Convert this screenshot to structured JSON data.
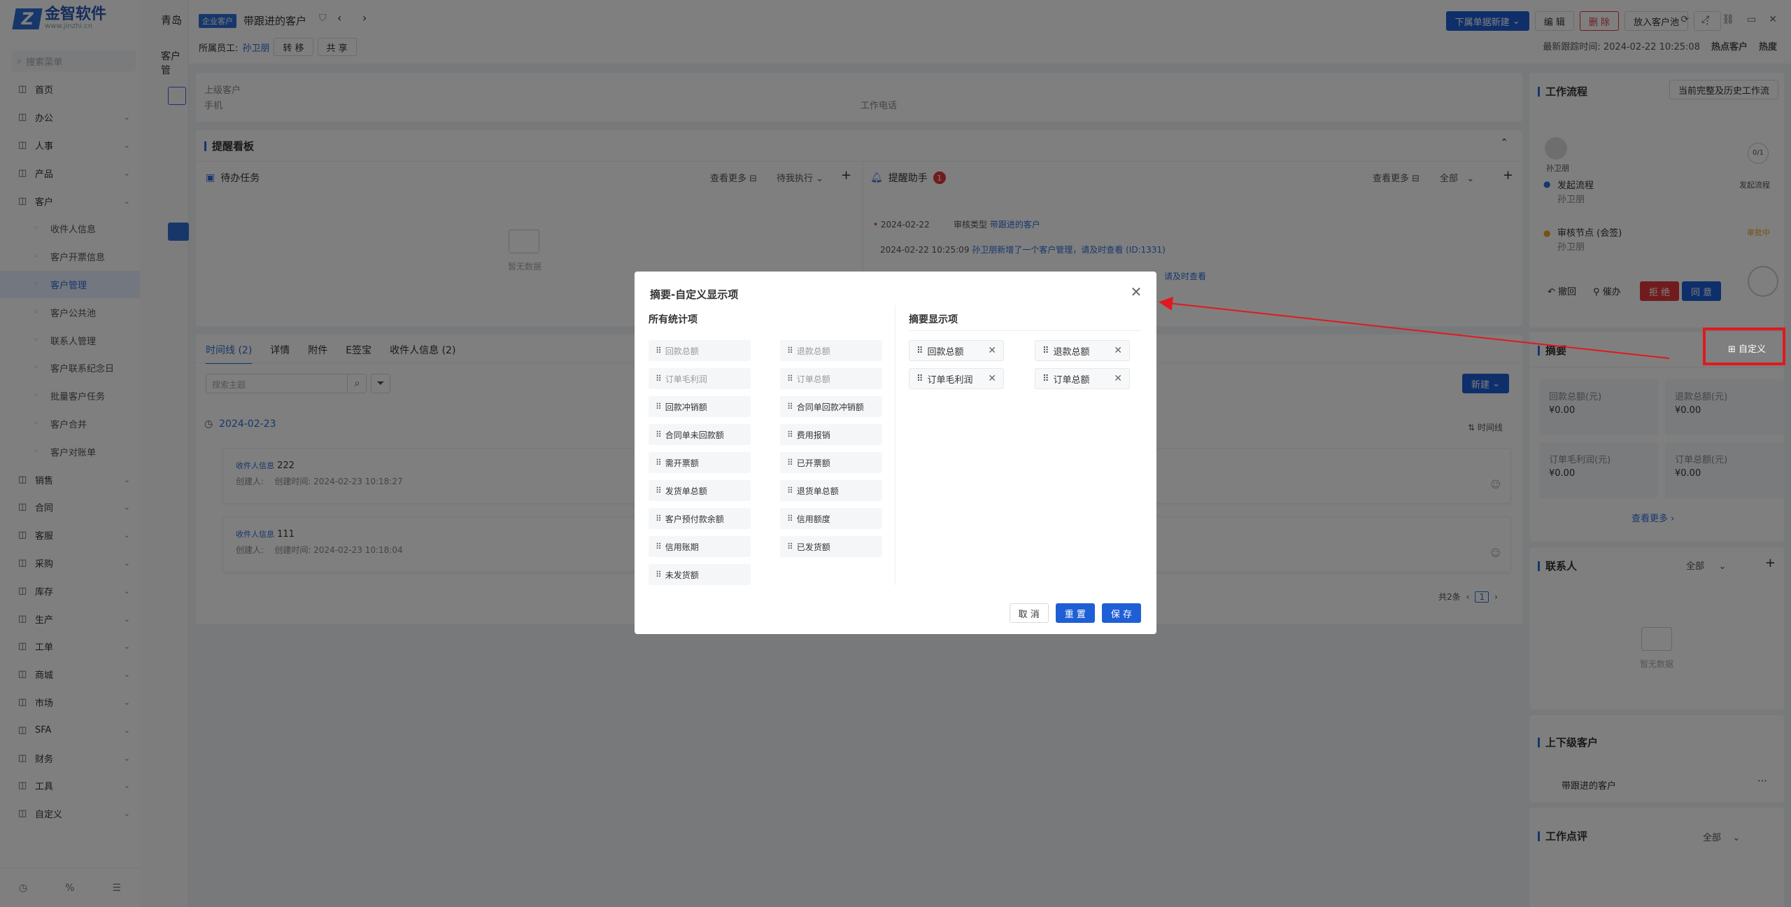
{
  "sidebar": {
    "logo_text": "金智软件",
    "logo_sub": "www.jinzhi.cn",
    "search_placeholder": "搜索菜单",
    "nav": [
      {
        "label": "首页",
        "icon": "home-icon",
        "sub": false,
        "chev": false
      },
      {
        "label": "办公",
        "icon": "office-icon",
        "sub": false,
        "chev": true
      },
      {
        "label": "人事",
        "icon": "user-icon",
        "sub": false,
        "chev": true
      },
      {
        "label": "产品",
        "icon": "product-icon",
        "sub": false,
        "chev": true
      },
      {
        "label": "客户",
        "icon": "customer-icon",
        "sub": false,
        "chev": true
      },
      {
        "label": "收件人信息",
        "sub": true
      },
      {
        "label": "客户开票信息",
        "sub": true
      },
      {
        "label": "客户管理",
        "sub": true,
        "active": true
      },
      {
        "label": "客户公共池",
        "sub": true
      },
      {
        "label": "联系人管理",
        "sub": true
      },
      {
        "label": "客户联系纪念日",
        "sub": true
      },
      {
        "label": "批量客户任务",
        "sub": true
      },
      {
        "label": "客户合并",
        "sub": true
      },
      {
        "label": "客户对账单",
        "sub": true
      },
      {
        "label": "销售",
        "icon": "sales-icon",
        "chev": true
      },
      {
        "label": "合同",
        "icon": "contract-icon",
        "chev": true
      },
      {
        "label": "客服",
        "icon": "service-icon",
        "chev": true
      },
      {
        "label": "采购",
        "icon": "purchase-icon",
        "chev": true
      },
      {
        "label": "库存",
        "icon": "stock-icon",
        "chev": true
      },
      {
        "label": "生产",
        "icon": "production-icon",
        "chev": true
      },
      {
        "label": "工单",
        "icon": "ticket-icon",
        "chev": true
      },
      {
        "label": "商城",
        "icon": "mall-icon",
        "chev": true
      },
      {
        "label": "市场",
        "icon": "market-icon",
        "chev": true
      },
      {
        "label": "SFA",
        "icon": "sfa-icon",
        "chev": true
      },
      {
        "label": "财务",
        "icon": "finance-icon",
        "chev": true
      },
      {
        "label": "工具",
        "icon": "tool-icon",
        "chev": true
      },
      {
        "label": "自定义",
        "icon": "custom-icon",
        "chev": true
      }
    ]
  },
  "header": {
    "breadcrumb_prefix": "青岛",
    "col2_title": "客户管",
    "badge": "企业客户",
    "customer_name": "带跟进的客户",
    "buttons": {
      "new_doc": "下属单据新建",
      "edit": "编 辑",
      "delete": "删 除",
      "to_pool": "放入客户池"
    },
    "owner_label": "所属员工:",
    "owner_name": "孙卫朋",
    "transfer": "转 移",
    "share": "共 享",
    "last_follow_label": "最新跟踪时间:",
    "last_follow_time": "2024-02-22 10:25:08",
    "hot_label": "热点客户",
    "heat_label": "热度"
  },
  "info": {
    "parent_label": "上级客户",
    "phone_label": "手机",
    "work_phone_label": "工作电话"
  },
  "reminder": {
    "title": "提醒看板",
    "todo_title": "待办任务",
    "view_more": "查看更多",
    "todo_filter": "待我执行",
    "empty": "暂无数据",
    "assistant_title": "提醒助手",
    "assistant_count": "1",
    "assistant_filter": "全部",
    "line1_date": "2024-02-22",
    "line1_label": "审核类型",
    "line1_value": "带跟进的客户",
    "line2_time": "2024-02-22 10:25:09",
    "line2_text": "孙卫朋新增了一个客户管理，请及时查看",
    "line2_id": "(ID:1331)",
    "line3_text": "请及时查看"
  },
  "timeline": {
    "tabs": [
      "时间线 (2)",
      "详情",
      "附件",
      "E签宝",
      "收件人信息 (2)"
    ],
    "search_placeholder": "搜索主题",
    "new_btn": "新建",
    "date": "2024-02-23",
    "view_label": "时间线",
    "items": [
      {
        "tag": "收件人信息",
        "title": "222",
        "creator": "创建人:",
        "created": "创建时间: 2024-02-23 10:18:27"
      },
      {
        "tag": "收件人信息",
        "title": "111",
        "creator": "创建人:",
        "created": "创建时间: 2024-02-23 10:18:04"
      }
    ],
    "total": "共2条",
    "page": "1"
  },
  "right": {
    "workflow_title": "工作流程",
    "history_btn": "当前完整及历史工作流",
    "avatar_name": "孙卫朋",
    "progress": "0/1",
    "step1_title": "发起流程",
    "step1_user": "孙卫朋",
    "step1_status": "发起流程",
    "step2_title": "审核节点 (会签)",
    "step2_user": "孙卫朋",
    "step2_status": "审批中",
    "recall": "撤回",
    "urge": "催办",
    "reject": "拒 绝",
    "agree": "同 意",
    "summary_title": "摘要",
    "custom_btn": "自定义",
    "stats": [
      {
        "label": "回款总额(元)",
        "value": "¥0.00"
      },
      {
        "label": "退款总额(元)",
        "value": "¥0.00"
      },
      {
        "label": "订单毛利润(元)",
        "value": "¥0.00"
      },
      {
        "label": "订单总额(元)",
        "value": "¥0.00"
      }
    ],
    "view_more": "查看更多",
    "contact_title": "联系人",
    "contact_filter": "全部",
    "empty": "暂无数据",
    "parent_title": "上下级客户",
    "parent_item": "带跟进的客户",
    "review_title": "工作点评",
    "review_filter": "全部"
  },
  "dialog": {
    "title": "摘要-自定义显示项",
    "left_title": "所有统计项",
    "right_title": "摘要显示项",
    "all_items": [
      {
        "label": "回款总额",
        "enabled": false
      },
      {
        "label": "退款总额",
        "enabled": false
      },
      {
        "label": "订单毛利润",
        "enabled": false
      },
      {
        "label": "订单总额",
        "enabled": false
      },
      {
        "label": "回款冲销额",
        "enabled": true
      },
      {
        "label": "合同单回款冲销额",
        "enabled": true
      },
      {
        "label": "合同单未回款额",
        "enabled": true
      },
      {
        "label": "费用报销",
        "enabled": true
      },
      {
        "label": "需开票额",
        "enabled": true
      },
      {
        "label": "已开票额",
        "enabled": true
      },
      {
        "label": "发货单总额",
        "enabled": true
      },
      {
        "label": "退货单总额",
        "enabled": true
      },
      {
        "label": "客户预付款余额",
        "enabled": true
      },
      {
        "label": "信用额度",
        "enabled": true
      },
      {
        "label": "信用账期",
        "enabled": true
      },
      {
        "label": "已发货额",
        "enabled": true
      },
      {
        "label": "未发货额",
        "enabled": true
      }
    ],
    "shown_items": [
      "回款总额",
      "退款总额",
      "订单毛利润",
      "订单总额"
    ],
    "cancel": "取 消",
    "reset": "重 置",
    "save": "保 存"
  },
  "colors": {
    "primary": "#1f5fd6",
    "danger": "#e0393e",
    "highlight": "#e0191e"
  }
}
